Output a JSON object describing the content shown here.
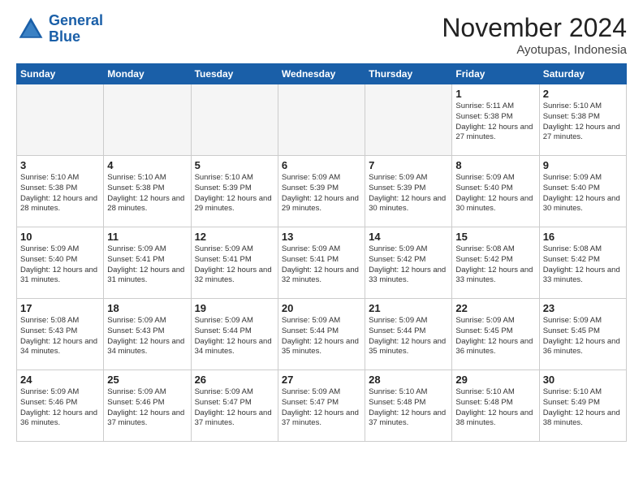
{
  "logo": {
    "line1": "General",
    "line2": "Blue"
  },
  "title": "November 2024",
  "location": "Ayotupas, Indonesia",
  "days_of_week": [
    "Sunday",
    "Monday",
    "Tuesday",
    "Wednesday",
    "Thursday",
    "Friday",
    "Saturday"
  ],
  "weeks": [
    [
      {
        "day": "",
        "info": ""
      },
      {
        "day": "",
        "info": ""
      },
      {
        "day": "",
        "info": ""
      },
      {
        "day": "",
        "info": ""
      },
      {
        "day": "",
        "info": ""
      },
      {
        "day": "1",
        "info": "Sunrise: 5:11 AM\nSunset: 5:38 PM\nDaylight: 12 hours\nand 27 minutes."
      },
      {
        "day": "2",
        "info": "Sunrise: 5:10 AM\nSunset: 5:38 PM\nDaylight: 12 hours\nand 27 minutes."
      }
    ],
    [
      {
        "day": "3",
        "info": "Sunrise: 5:10 AM\nSunset: 5:38 PM\nDaylight: 12 hours\nand 28 minutes."
      },
      {
        "day": "4",
        "info": "Sunrise: 5:10 AM\nSunset: 5:38 PM\nDaylight: 12 hours\nand 28 minutes."
      },
      {
        "day": "5",
        "info": "Sunrise: 5:10 AM\nSunset: 5:39 PM\nDaylight: 12 hours\nand 29 minutes."
      },
      {
        "day": "6",
        "info": "Sunrise: 5:09 AM\nSunset: 5:39 PM\nDaylight: 12 hours\nand 29 minutes."
      },
      {
        "day": "7",
        "info": "Sunrise: 5:09 AM\nSunset: 5:39 PM\nDaylight: 12 hours\nand 30 minutes."
      },
      {
        "day": "8",
        "info": "Sunrise: 5:09 AM\nSunset: 5:40 PM\nDaylight: 12 hours\nand 30 minutes."
      },
      {
        "day": "9",
        "info": "Sunrise: 5:09 AM\nSunset: 5:40 PM\nDaylight: 12 hours\nand 30 minutes."
      }
    ],
    [
      {
        "day": "10",
        "info": "Sunrise: 5:09 AM\nSunset: 5:40 PM\nDaylight: 12 hours\nand 31 minutes."
      },
      {
        "day": "11",
        "info": "Sunrise: 5:09 AM\nSunset: 5:41 PM\nDaylight: 12 hours\nand 31 minutes."
      },
      {
        "day": "12",
        "info": "Sunrise: 5:09 AM\nSunset: 5:41 PM\nDaylight: 12 hours\nand 32 minutes."
      },
      {
        "day": "13",
        "info": "Sunrise: 5:09 AM\nSunset: 5:41 PM\nDaylight: 12 hours\nand 32 minutes."
      },
      {
        "day": "14",
        "info": "Sunrise: 5:09 AM\nSunset: 5:42 PM\nDaylight: 12 hours\nand 33 minutes."
      },
      {
        "day": "15",
        "info": "Sunrise: 5:08 AM\nSunset: 5:42 PM\nDaylight: 12 hours\nand 33 minutes."
      },
      {
        "day": "16",
        "info": "Sunrise: 5:08 AM\nSunset: 5:42 PM\nDaylight: 12 hours\nand 33 minutes."
      }
    ],
    [
      {
        "day": "17",
        "info": "Sunrise: 5:08 AM\nSunset: 5:43 PM\nDaylight: 12 hours\nand 34 minutes."
      },
      {
        "day": "18",
        "info": "Sunrise: 5:09 AM\nSunset: 5:43 PM\nDaylight: 12 hours\nand 34 minutes."
      },
      {
        "day": "19",
        "info": "Sunrise: 5:09 AM\nSunset: 5:44 PM\nDaylight: 12 hours\nand 34 minutes."
      },
      {
        "day": "20",
        "info": "Sunrise: 5:09 AM\nSunset: 5:44 PM\nDaylight: 12 hours\nand 35 minutes."
      },
      {
        "day": "21",
        "info": "Sunrise: 5:09 AM\nSunset: 5:44 PM\nDaylight: 12 hours\nand 35 minutes."
      },
      {
        "day": "22",
        "info": "Sunrise: 5:09 AM\nSunset: 5:45 PM\nDaylight: 12 hours\nand 36 minutes."
      },
      {
        "day": "23",
        "info": "Sunrise: 5:09 AM\nSunset: 5:45 PM\nDaylight: 12 hours\nand 36 minutes."
      }
    ],
    [
      {
        "day": "24",
        "info": "Sunrise: 5:09 AM\nSunset: 5:46 PM\nDaylight: 12 hours\nand 36 minutes."
      },
      {
        "day": "25",
        "info": "Sunrise: 5:09 AM\nSunset: 5:46 PM\nDaylight: 12 hours\nand 37 minutes."
      },
      {
        "day": "26",
        "info": "Sunrise: 5:09 AM\nSunset: 5:47 PM\nDaylight: 12 hours\nand 37 minutes."
      },
      {
        "day": "27",
        "info": "Sunrise: 5:09 AM\nSunset: 5:47 PM\nDaylight: 12 hours\nand 37 minutes."
      },
      {
        "day": "28",
        "info": "Sunrise: 5:10 AM\nSunset: 5:48 PM\nDaylight: 12 hours\nand 37 minutes."
      },
      {
        "day": "29",
        "info": "Sunrise: 5:10 AM\nSunset: 5:48 PM\nDaylight: 12 hours\nand 38 minutes."
      },
      {
        "day": "30",
        "info": "Sunrise: 5:10 AM\nSunset: 5:49 PM\nDaylight: 12 hours\nand 38 minutes."
      }
    ]
  ]
}
